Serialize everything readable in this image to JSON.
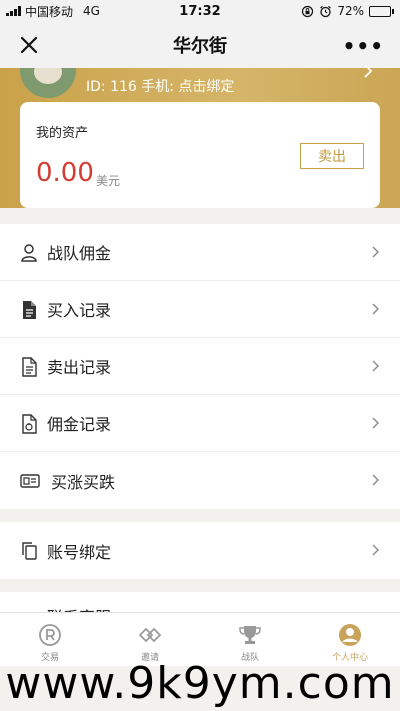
{
  "status_bar": {
    "carrier": "中国移动",
    "network": "4G",
    "time": "17:32",
    "battery": "72%",
    "battery_level": 0.72
  },
  "navbar": {
    "title": "华尔街",
    "close_icon": "close-icon",
    "more_icon": "more-icon"
  },
  "profile": {
    "id_line": "ID: 116 手机: 点击绑定"
  },
  "assets": {
    "label": "我的资产",
    "amount": "0.00",
    "unit": "美元",
    "sell_button": "卖出"
  },
  "menu_group_1": [
    {
      "label": "战队佣金",
      "icon": "person-icon"
    },
    {
      "label": "买入记录",
      "icon": "document-filled-icon"
    },
    {
      "label": "卖出记录",
      "icon": "document-icon"
    },
    {
      "label": "佣金记录",
      "icon": "money-document-icon"
    },
    {
      "label": "买涨买跌",
      "icon": "ticket-icon"
    }
  ],
  "menu_group_2": [
    {
      "label": "账号绑定",
      "icon": "copy-icon"
    }
  ],
  "menu_group_3_peek": "联系客服",
  "tabbar": [
    {
      "label": "交易",
      "icon": "registered-icon",
      "active": false
    },
    {
      "label": "邀请",
      "icon": "link-diamond-icon",
      "active": false
    },
    {
      "label": "战队",
      "icon": "trophy-icon",
      "active": false
    },
    {
      "label": "个人中心",
      "icon": "user-circle-icon",
      "active": true
    }
  ],
  "watermark": "www.9k9ym.com",
  "colors": {
    "gold": "#c9a24a",
    "accent_red": "#d43c33",
    "sell_border": "#c7a14b",
    "tab_active": "#c9a35a"
  }
}
